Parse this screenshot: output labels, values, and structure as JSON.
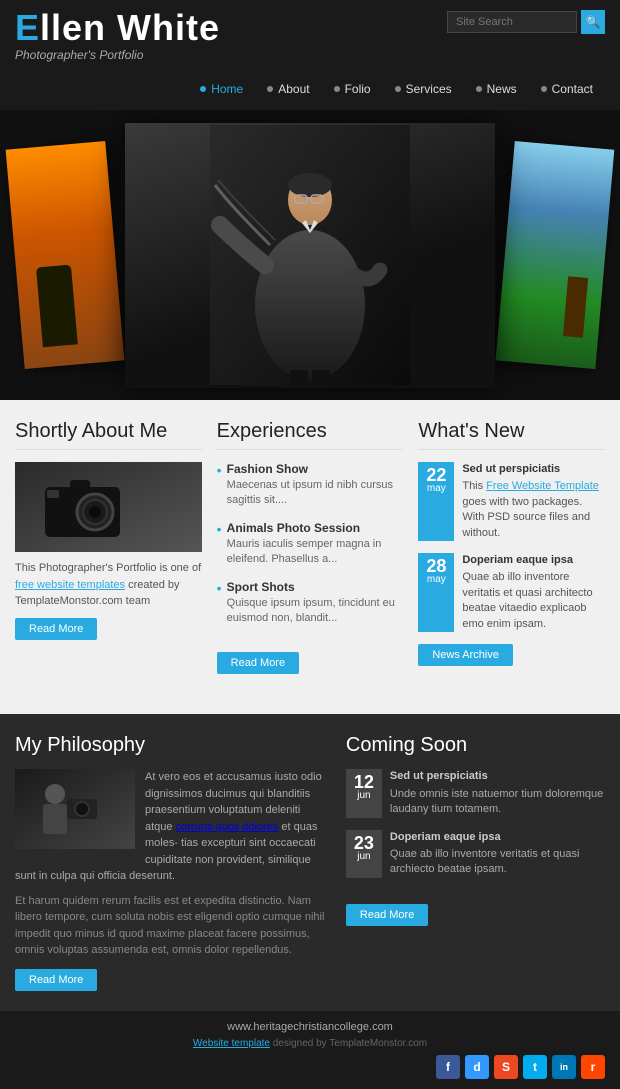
{
  "site": {
    "title_prefix": "E",
    "title_rest": "llen ",
    "title_bold": "White",
    "subtitle": "Photographer's Portfolio"
  },
  "search": {
    "placeholder": "Site Search",
    "button_icon": "🔍"
  },
  "nav": {
    "items": [
      {
        "label": "Home",
        "active": true
      },
      {
        "label": "About",
        "active": false
      },
      {
        "label": "Folio",
        "active": false
      },
      {
        "label": "Services",
        "active": false
      },
      {
        "label": "News",
        "active": false
      },
      {
        "label": "Contact",
        "active": false
      }
    ]
  },
  "about": {
    "title": "Shortly About Me",
    "text1": "This Photographer's Portfolio is one of ",
    "link_text": "free website templates",
    "link_url": "#",
    "text2": " created by TemplateMonstor.com team",
    "read_more": "Read More"
  },
  "experiences": {
    "title": "Experiences",
    "items": [
      {
        "title": "Fashion Show",
        "desc": "Maecenas ut ipsum id nibh cursus sagittis sit...."
      },
      {
        "title": "Animals Photo Session",
        "desc": "Mauris iaculis semper magna in eleifend. Phasellus a..."
      },
      {
        "title": "Sport Shots",
        "desc": "Quisque ipsum ipsum, tincidunt eu euismod non, blandit..."
      }
    ],
    "read_more": "Read More"
  },
  "whats_new": {
    "title": "What's New",
    "items": [
      {
        "date_num": "22",
        "date_month": "may",
        "title": "Sed ut perspiciatis",
        "text": "This ",
        "link_text": "Free Website Template",
        "text2": " goes with two packages. With PSD source files and without."
      },
      {
        "date_num": "28",
        "date_month": "may",
        "title": "Doperiam eaque ipsa",
        "text": "Quae ab illo inventore veritatis et quasi architecto beatae vitaedio explicaob emo enim ipsam."
      }
    ],
    "archive_btn": "News Archive"
  },
  "philosophy": {
    "title": "My Philosophy",
    "quote": "At vero eos et accusamus iusto odio dignissimos ducimus qui blanditiis praesentium voluptatum deleniti atque ",
    "link_text": "corrupti quos dolores",
    "quote2": " et quas moles- tias excepturi sint occaecati cupiditate non provident, similique sunt in culpa qui officia deserunt.",
    "body": "Et harum quidem rerum facilis est et expedita distinctio. Nam libero tempore, cum soluta nobis est eligendi optio cumque nihil impedit quo minus id quod maxime placeat facere possimus, omnis voluptas assumenda est, omnis dolor repellendus.",
    "read_more": "Read More"
  },
  "coming_soon": {
    "title": "Coming Soon",
    "items": [
      {
        "date_num": "12",
        "date_month": "jun",
        "title": "Sed ut perspiciatis",
        "text": "Unde omnis iste natuemor tium doloremque laudany tium totamem."
      },
      {
        "date_num": "23",
        "date_month": "jun",
        "title": "Doperiam eaque ipsa",
        "text": "Quae ab illo inventore veritatis et quasi archiecto beatae ipsam."
      }
    ],
    "read_more": "Read More"
  },
  "footer": {
    "url": "www.heritagechristiancollege.com",
    "credit_text": "Website template",
    "credit_rest": " designed by TemplateMonstor.com"
  },
  "social": [
    {
      "name": "facebook",
      "label": "f",
      "color": "#3b5998"
    },
    {
      "name": "delicious",
      "label": "d",
      "color": "#3399ff"
    },
    {
      "name": "stumbleupon",
      "label": "S",
      "color": "#eb4823"
    },
    {
      "name": "twitter",
      "label": "t",
      "color": "#00acee"
    },
    {
      "name": "linkedin",
      "label": "in",
      "color": "#0077b5"
    },
    {
      "name": "reddit",
      "label": "r",
      "color": "#ff4500"
    }
  ]
}
